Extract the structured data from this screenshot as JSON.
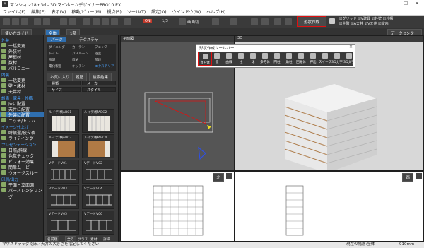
{
  "titlebar": {
    "title": "マンション18m3d - 3D マイホームデザイナーPRO10 EX",
    "icon": "app-icon"
  },
  "menu": [
    "ファイル(F)",
    "編集(E)",
    "表示(V)",
    "移動/ビュー(M)",
    "視点(S)",
    "ツール(T)",
    "設定(O)",
    "ウインドウ(W)",
    "ヘルプ(H)"
  ],
  "toolbar": {
    "on_label": "ON",
    "fraction": "1/3",
    "view_label": "画面切",
    "shape_button": "形状作成",
    "checks": [
      "グリッド",
      "V建具",
      "外壁",
      "外構",
      "全階",
      "A天井",
      "V天井",
      "室内"
    ]
  },
  "row2": {
    "left_button": "使い方ガイド",
    "tabs": [
      "全体",
      "1階"
    ],
    "right_button": "データセンター"
  },
  "sidebar": {
    "sections": [
      {
        "head": "外装",
        "items": [
          "一括変更",
          "外装材",
          "屋根材",
          "数材",
          "バルコニー"
        ]
      },
      {
        "head": "内装",
        "items": [
          "一括変更",
          "壁・床材",
          "天井材"
        ]
      },
      {
        "head": "設備・家具・外構",
        "items": [
          "床に配置",
          "天井に配置",
          "外装に配置",
          "ニッチ/トリム"
        ]
      },
      {
        "head": "イメージ仕上げ",
        "items": [
          "時候選/夜夕夜",
          "ライティング"
        ]
      },
      {
        "head": "プレゼンテーション",
        "items": [
          "日照/斜線",
          "色覚チェック",
          "ビフォー効果",
          "簡単ムービー",
          "ウォークスルー"
        ]
      },
      {
        "head": "印刷/出力",
        "items": [
          "平面・立面図",
          "パースレンダリング"
        ]
      }
    ],
    "selected": "外装に配置"
  },
  "library": {
    "tabs": [
      "パーツ",
      "テクスチャ"
    ],
    "categories": [
      "ダイニング",
      "カーテン",
      "フェンス",
      "トイレ",
      "パスルーム",
      "浴室",
      "照明",
      "収納",
      "階段",
      "電化製品",
      "キッチン",
      "エクステリア"
    ],
    "search_label": "お気に入り",
    "history_label": "履歴",
    "results_label": "検索結果",
    "dropdowns": [
      "種類",
      "メーカー",
      "サイズ",
      "スタイル"
    ],
    "thumbs": [
      "ルイデ/横ABC1",
      "ルイデ/横ABC2",
      "ルイデ/横ABC3",
      "ルイデ/横ABC4",
      "Vデ一ドV01",
      "Vデ一ドV02",
      "Vデ一ドV03",
      "Vデ一ドV04",
      "Vデ一ドV05",
      "Vデ一ドV06"
    ],
    "footer": [
      "名前順",
      "全て",
      "グラス",
      "素材",
      "詳細"
    ]
  },
  "viewports": {
    "plan_label": "平面図",
    "persp_label": "3D",
    "elev1_label": "北",
    "elev2_label": "西"
  },
  "palette": {
    "title": "形状作成ツールバー",
    "buttons": [
      "直方体",
      "壁",
      "曲線",
      "柱",
      "球",
      "多方体",
      "円柱",
      "角柱",
      "回転体",
      "押出",
      "スイープ",
      "3D文字",
      "3D文字"
    ],
    "highlight": "直方体"
  },
  "status": {
    "left": "マウスドラッグで床／天井の大きさを指定してください",
    "right": "現在の階層:全体",
    "zoom": "910mm"
  }
}
